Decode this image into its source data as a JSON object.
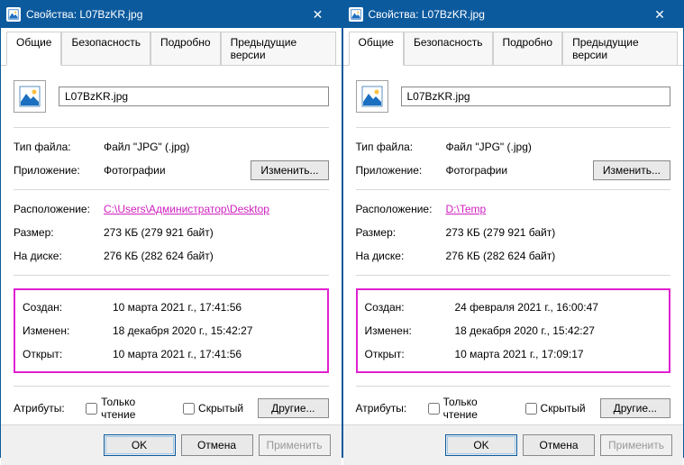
{
  "windows": [
    {
      "title": "Свойства: L07BzKR.jpg",
      "tabs": [
        "Общие",
        "Безопасность",
        "Подробно",
        "Предыдущие версии"
      ],
      "filename": "L07BzKR.jpg",
      "labels": {
        "filetype": "Тип файла:",
        "application": "Приложение:",
        "location": "Расположение:",
        "size": "Размер:",
        "ondisk": "На диске:",
        "created": "Создан:",
        "modified": "Изменен:",
        "accessed": "Открыт:",
        "attributes": "Атрибуты:",
        "readonly": "Только чтение",
        "hidden": "Скрытый"
      },
      "values": {
        "filetype": "Файл \"JPG\" (.jpg)",
        "application": "Фотографии",
        "location": "C:\\Users\\Администратор\\Desktop",
        "size": "273 КБ (279 921 байт)",
        "ondisk": "276 КБ (282 624 байт)",
        "created": "10 марта 2021 г., 17:41:56",
        "modified": "18 декабря 2020 г., 15:42:27",
        "accessed": "10 марта 2021 г., 17:41:56"
      },
      "buttons": {
        "change": "Изменить...",
        "other": "Другие...",
        "ok": "OK",
        "cancel": "Отмена",
        "apply": "Применить"
      }
    },
    {
      "title": "Свойства: L07BzKR.jpg",
      "tabs": [
        "Общие",
        "Безопасность",
        "Подробно",
        "Предыдущие версии"
      ],
      "filename": "L07BzKR.jpg",
      "labels": {
        "filetype": "Тип файла:",
        "application": "Приложение:",
        "location": "Расположение:",
        "size": "Размер:",
        "ondisk": "На диске:",
        "created": "Создан:",
        "modified": "Изменен:",
        "accessed": "Открыт:",
        "attributes": "Атрибуты:",
        "readonly": "Только чтение",
        "hidden": "Скрытый"
      },
      "values": {
        "filetype": "Файл \"JPG\" (.jpg)",
        "application": "Фотографии",
        "location": "D:\\Temp",
        "size": "273 КБ (279 921 байт)",
        "ondisk": "276 КБ (282 624 байт)",
        "created": "24 февраля 2021 г., 16:00:47",
        "modified": "18 декабря 2020 г., 15:42:27",
        "accessed": "10 марта 2021 г., 17:09:17"
      },
      "buttons": {
        "change": "Изменить...",
        "other": "Другие...",
        "ok": "OK",
        "cancel": "Отмена",
        "apply": "Применить"
      }
    }
  ]
}
